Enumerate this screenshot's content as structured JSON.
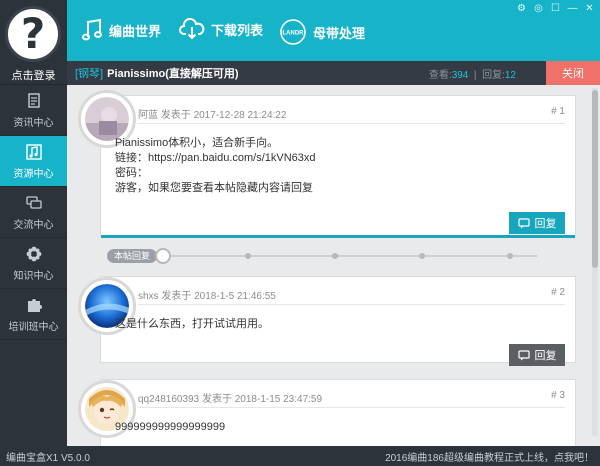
{
  "sidebar": {
    "login_label": "点击登录",
    "avatar_glyph": "?",
    "items": [
      {
        "label": "资讯中心",
        "icon": "document-icon",
        "active": false
      },
      {
        "label": "资源中心",
        "icon": "music-note-icon",
        "active": true
      },
      {
        "label": "交流中心",
        "icon": "chat-bubbles-icon",
        "active": false
      },
      {
        "label": "知识中心",
        "icon": "knowledge-flower-icon",
        "active": false
      },
      {
        "label": "培训班中心",
        "icon": "puzzle-icon",
        "active": false
      }
    ]
  },
  "topbar": {
    "buttons": [
      {
        "label": "编曲世界",
        "icon": "music-note-icon"
      },
      {
        "label": "下载列表",
        "icon": "cloud-download-icon"
      },
      {
        "label": "母带处理",
        "icon": "landr-logo-icon",
        "logo_text": "LANDR"
      }
    ],
    "window_controls": [
      "gear-icon",
      "chat-icon",
      "shirt-icon",
      "minimize-icon",
      "close-icon"
    ],
    "window_glyphs": [
      "⚙",
      "◎",
      "☐",
      "—",
      "✕"
    ]
  },
  "thread": {
    "tag": "[钢琴]",
    "title": "Pianissimo(直接解压可用)",
    "views_label": "查看:",
    "views": "394",
    "replies_label": "回复:",
    "replies": "12",
    "close_label": "关闭"
  },
  "timeline": {
    "label": "本帖回复"
  },
  "posts": [
    {
      "author": "阿蓝",
      "posted_label": "发表于",
      "date": "2017-12-28 21:24:22",
      "number": "# 1",
      "lines": [
        "Pianissimo体积小，适合新手向。",
        "链接：https://pan.baidu.com/s/1kVN63xd",
        "密码：",
        "游客，如果您要查看本帖隐藏内容请回复"
      ],
      "reply_label": "回复"
    },
    {
      "author": "shxs",
      "posted_label": "发表于",
      "date": "2018-1-5 21:46:55",
      "number": "# 2",
      "lines": [
        "这是什么东西，打开试试用用。"
      ],
      "reply_label": "回复"
    },
    {
      "author": "qq248160393",
      "posted_label": "发表于",
      "date": "2018-1-15 23:47:59",
      "number": "# 3",
      "lines": [
        "999999999999999999"
      ]
    }
  ],
  "statusbar": {
    "version": "编曲宝盒X1  V5.0.0",
    "announcement": "2016编曲186超级编曲教程正式上线，点我吧！"
  },
  "colors": {
    "accent": "#17b3c9",
    "sidebar_bg": "#2d333b",
    "close_red": "#f0706a"
  }
}
